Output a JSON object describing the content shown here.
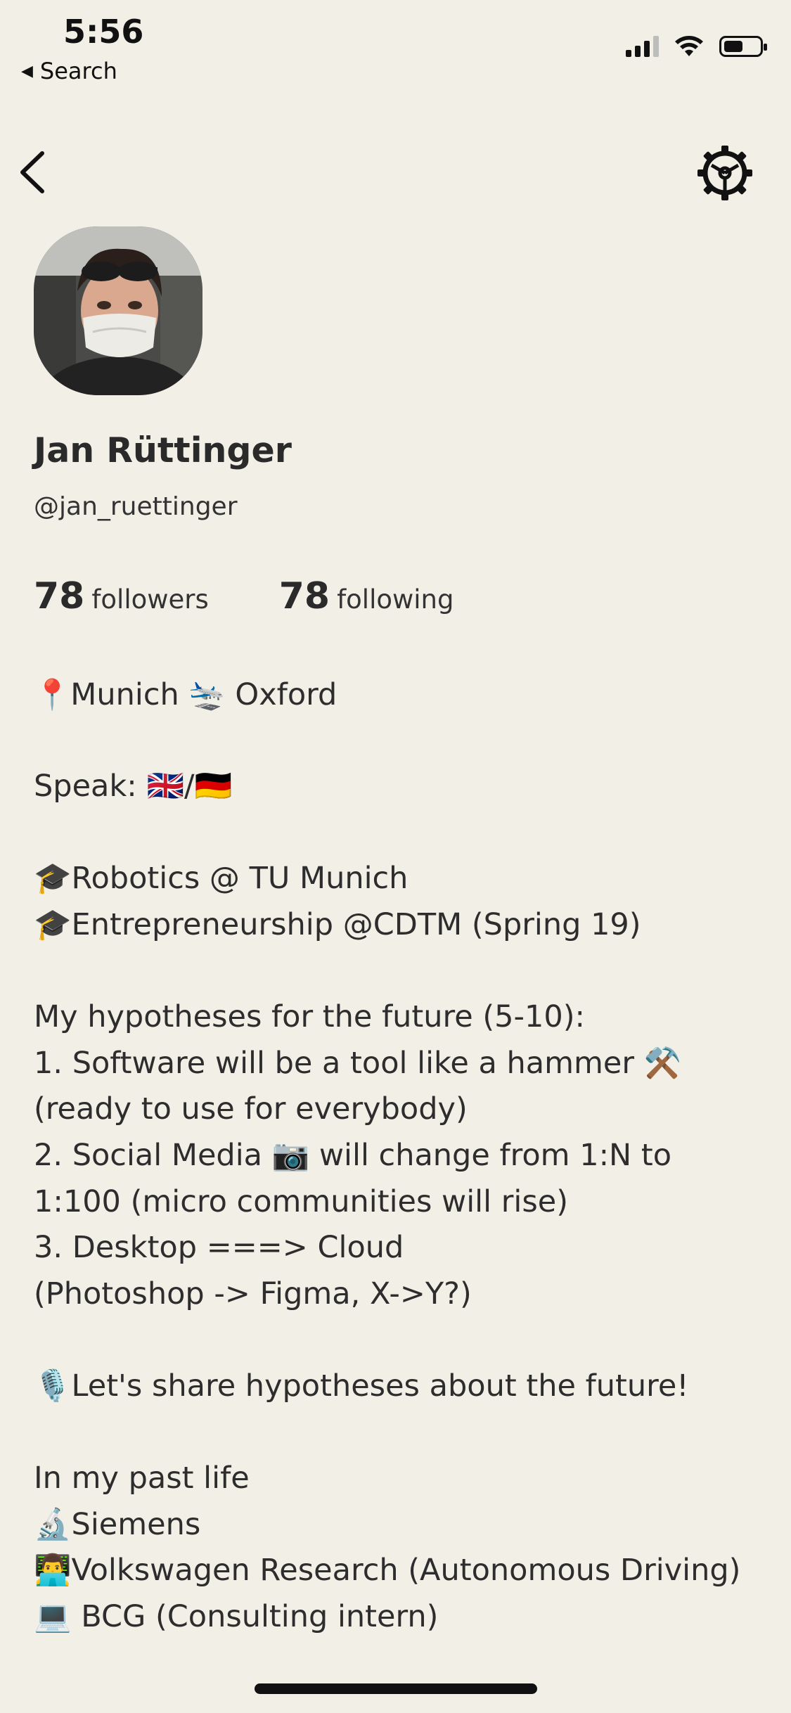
{
  "status_bar": {
    "time": "5:56",
    "back_app": "Search",
    "back_arrow": "◀",
    "battery_percent": 55
  },
  "profile": {
    "name": "Jan Rüttinger",
    "handle": "@jan_ruettinger",
    "followers_count": "78",
    "followers_label": "followers",
    "following_count": "78",
    "following_label": "following"
  },
  "bio": {
    "location_line": {
      "pin_emoji": "📍",
      "from": "Munich",
      "plane_emoji": "🛬",
      "to": "Oxford"
    },
    "speak_line": "Speak: 🇬🇧/🇩🇪",
    "edu_1": "🎓Robotics @ TU Munich",
    "edu_2": "🎓Entrepreneurship @CDTM (Spring 19)",
    "hyp_title": "My hypotheses for the future (5-10):",
    "hyp_1a": "1. Software will be a tool like a hammer ⚒️",
    "hyp_1b": "(ready to use for everybody)",
    "hyp_2a": "2. Social Media 📷 will change from 1:N to",
    "hyp_2b": "1:100 (micro communities will rise)",
    "hyp_3a": "3. Desktop ===> Cloud",
    "hyp_3b": "(Photoshop -> Figma, X->Y?)",
    "share_line": "🎙️Let's share hypotheses about the future!",
    "past_title": "In my past life",
    "past_1": "🔬Siemens",
    "past_2": "👨‍💻Volkswagen Research (Autonomous Driving)",
    "past_3": "💻 BCG (Consulting intern)"
  },
  "icons": {
    "back": "chevron-left-icon",
    "settings": "gear-icon"
  }
}
